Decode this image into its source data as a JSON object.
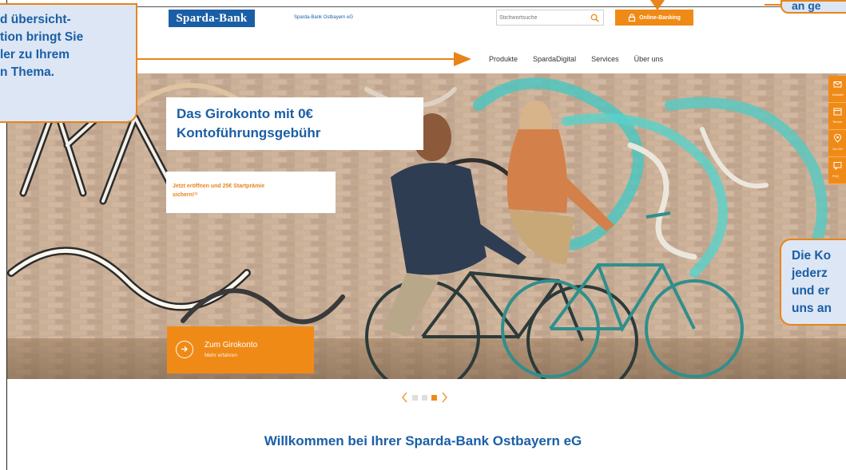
{
  "header": {
    "logo_text": "Sparda-Bank",
    "bank_name": "Sparda-Bank Ostbayern eG",
    "search_placeholder": "Stichwortsuche",
    "online_banking_label": "Online-Banking"
  },
  "nav": {
    "items": [
      "Produkte",
      "SpardaDigital",
      "Services",
      "Über uns"
    ]
  },
  "hero": {
    "title_line1": "Das Girokonto mit 0€",
    "title_line2": "Kontoführungsgebühr",
    "subtitle_line1": "Jetzt eröffnen und 25€ Startprämie",
    "subtitle_line2": "sichern!¹⁾",
    "cta_label": "Zum Girokonto",
    "cta_sub": "Mehr erfahren"
  },
  "side_strip": {
    "items": [
      {
        "label": "Kontakt",
        "icon": "mail-icon"
      },
      {
        "label": "Termin",
        "icon": "calendar-icon"
      },
      {
        "label": "Vor Ort",
        "icon": "location-pin-icon"
      },
      {
        "label": "FAQ",
        "icon": "chat-icon"
      }
    ]
  },
  "carousel": {
    "slides": 3,
    "active_index": 2
  },
  "welcome": {
    "heading": "Willkommen bei Ihrer Sparda-Bank Ostbayern eG"
  },
  "callouts": {
    "left_lines": [
      "d übersicht-",
      "tion bringt Sie",
      "ler zu Ihrem",
      "n Thema."
    ],
    "right_top_text": "an ge",
    "right_lines": [
      "Die Ko",
      "jederz",
      "und er",
      "uns an"
    ]
  },
  "colors": {
    "brand_blue": "#1a5fa6",
    "accent_orange": "#f08a17",
    "callout_bg": "#dde6f4"
  }
}
